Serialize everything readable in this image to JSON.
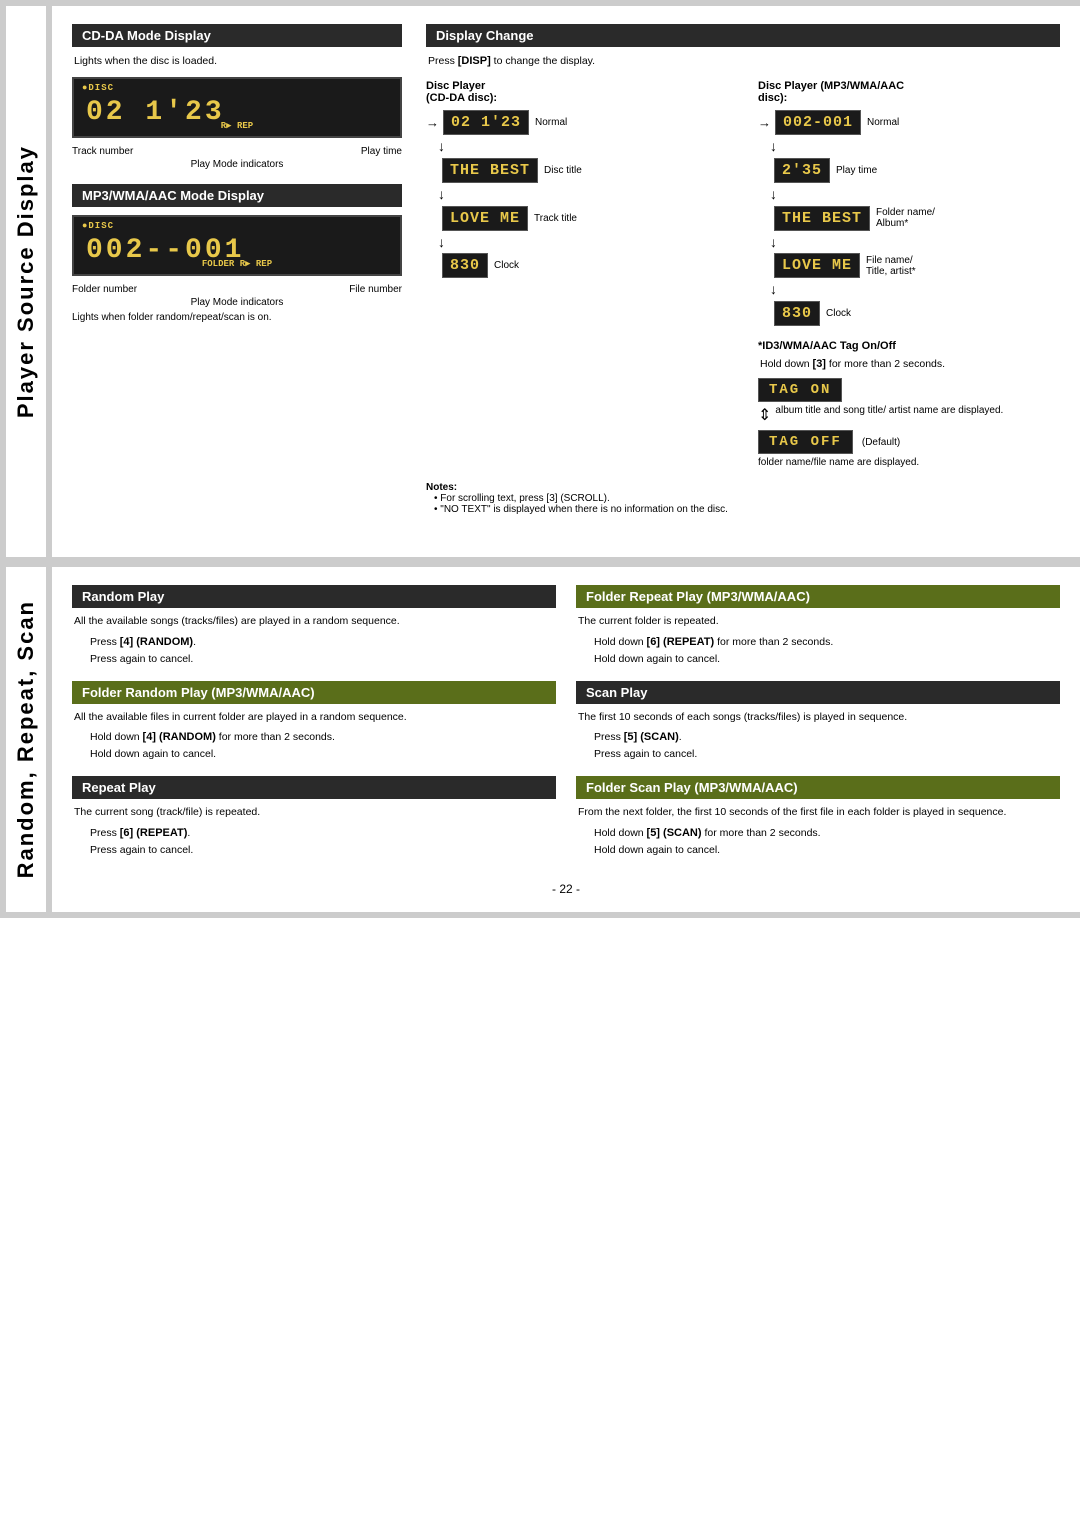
{
  "page": {
    "page_number": "- 22 -",
    "top_border": "",
    "bottom_border": ""
  },
  "top_section": {
    "sidebar_label": "Player Source Display",
    "cdda_section": {
      "header": "CD-DA Mode Display",
      "description": "Lights when the disc is loaded.",
      "disc_indicator": "●DISC",
      "display_main": "02  1'23",
      "sub_indicator": "R▶ REP",
      "label_left": "Track number",
      "label_right": "Play time",
      "label_center": "Play Mode indicators"
    },
    "mp3_section": {
      "header": "MP3/WMA/AAC Mode Display",
      "disc_indicator": "●DISC",
      "display_main": "002--001",
      "sub_indicator": "FOLDER R▶ REP",
      "label_left": "Folder number",
      "label_right": "File number",
      "label_center": "Play Mode indicators",
      "note_below": "Lights when folder random/repeat/scan is on."
    },
    "display_change": {
      "header": "Display Change",
      "description": "Press [DISP] to change the display.",
      "disc_player_col_title": "Disc Player\n(CD-DA disc):",
      "disc_player_mp3_col_title": "Disc Player (MP3/WMA/AAC\ndisc):",
      "cdda_flow": [
        {
          "display": "02  1'23",
          "label": "Normal",
          "arrow": "→"
        },
        {
          "display": "THE BEST",
          "label": "Disc title",
          "arrow": "↓"
        },
        {
          "display": "LOVE ME",
          "label": "Track title",
          "arrow": "↓"
        },
        {
          "display": "830",
          "label": "Clock",
          "arrow": "↓"
        }
      ],
      "mp3_flow": [
        {
          "display": "002-001",
          "label": "Normal",
          "arrow": "→"
        },
        {
          "display": "2'35",
          "label": "Play time",
          "arrow": "↓"
        },
        {
          "display": "THE BEST",
          "label": "Folder name/\nAlbum*",
          "arrow": "↓"
        },
        {
          "display": "LOVE ME",
          "label": "File name/\nTitle, artist*",
          "arrow": "↓"
        },
        {
          "display": "830",
          "label": "Clock",
          "arrow": "↓"
        }
      ],
      "tag_section": {
        "header": "*ID3/WMA/AAC Tag On/Off",
        "instruction": "Hold down [3] for more than 2 seconds.",
        "tag_on_display": "TAG ON",
        "tag_on_desc": "album title and song title/\nartist name are displayed.",
        "tag_off_display": "TAG OFF",
        "tag_off_desc": "(Default)",
        "tag_off_note": "folder name/file name are\ndisplayed."
      },
      "notes": {
        "title": "Notes:",
        "items": [
          "For scrolling text, press [3] (SCROLL).",
          "\"NO TEXT\" is displayed when there is no information on the disc."
        ]
      }
    }
  },
  "bottom_section": {
    "sidebar_label": "Random, Repeat, Scan",
    "left_col": {
      "random_play": {
        "header": "Random Play",
        "description": "All the available songs (tracks/files) are played in a random sequence.",
        "body": "Press [4] (RANDOM).\nPress again to cancel."
      },
      "folder_random_play": {
        "header": "Folder Random Play (MP3/WMA/AAC)",
        "description": "All the available files in current folder are played in a random sequence.",
        "body": "Hold down [4] (RANDOM) for more than 2 seconds.\nHold down again to cancel."
      },
      "repeat_play": {
        "header": "Repeat Play",
        "description": "The current song (track/file) is repeated.",
        "body": "Press [6] (REPEAT).\nPress again to cancel."
      }
    },
    "right_col": {
      "folder_repeat_play": {
        "header": "Folder Repeat Play (MP3/WMA/AAC)",
        "description": "The current folder is repeated.",
        "body": "Hold down [6] (REPEAT) for more than 2 seconds.\nHold down again to cancel."
      },
      "scan_play": {
        "header": "Scan Play",
        "description": "The first 10 seconds of each songs (tracks/files) is played in sequence.",
        "body": "Press [5] (SCAN).\nPress again to cancel."
      },
      "folder_scan_play": {
        "header": "Folder Scan Play (MP3/WMA/AAC)",
        "description": "From the next folder, the first 10 seconds of the first file in each folder is played in sequence.",
        "body": "Hold down [5] (SCAN) for more than 2 seconds.\nHold down again to cancel."
      }
    }
  }
}
